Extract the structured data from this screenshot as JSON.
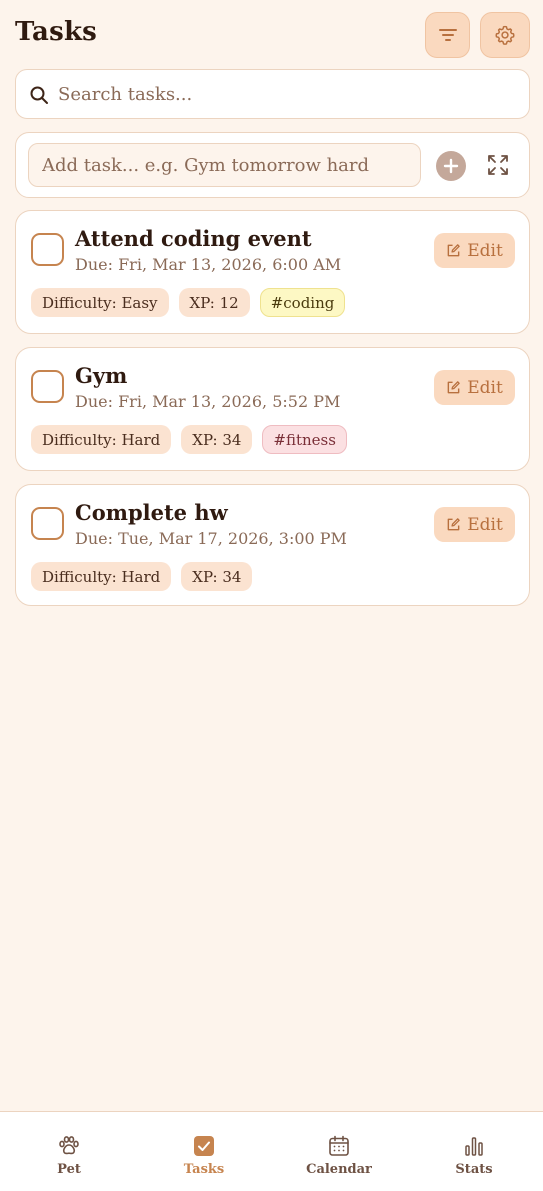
{
  "header": {
    "title": "Tasks"
  },
  "search": {
    "placeholder": "Search tasks..."
  },
  "add_task": {
    "placeholder": "Add task... e.g. Gym tomorrow hard"
  },
  "edit_label": "Edit",
  "tasks": [
    {
      "title": "Attend coding event",
      "due": "Due: Fri, Mar 13, 2026, 6:00 AM",
      "difficulty": "Difficulty: Easy",
      "xp": "XP: 12",
      "tag": "#coding",
      "tag_color": "#fdf8c4"
    },
    {
      "title": "Gym",
      "due": "Due: Fri, Mar 13, 2026, 5:52 PM",
      "difficulty": "Difficulty: Hard",
      "xp": "XP: 34",
      "tag": "#fitness",
      "tag_color": "#fbe0e2"
    },
    {
      "title": "Complete hw",
      "due": "Due: Tue, Mar 17, 2026, 3:00 PM",
      "difficulty": "Difficulty: Hard",
      "xp": "XP: 34"
    }
  ],
  "nav": {
    "items": [
      {
        "label": "Pet",
        "icon": "paw-icon"
      },
      {
        "label": "Tasks",
        "icon": "task-check-icon",
        "active": true
      },
      {
        "label": "Calendar",
        "icon": "calendar-icon"
      },
      {
        "label": "Stats",
        "icon": "bar-chart-icon"
      }
    ]
  },
  "colors": {
    "background": "#fdf4ec",
    "accent": "#c6844f",
    "accent_soft": "#fad9bf",
    "text_dark": "#2f1a10",
    "text_muted": "#8a6a57"
  }
}
